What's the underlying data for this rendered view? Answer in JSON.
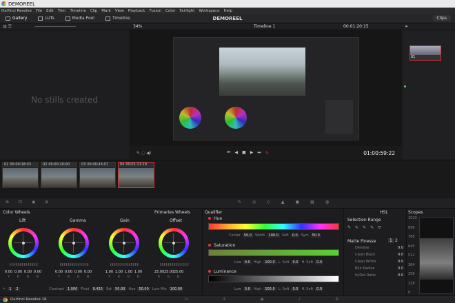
{
  "window": {
    "title": "DEMOREEL"
  },
  "menu": [
    "DaVinci Resolve",
    "File",
    "Edit",
    "Trim",
    "Timeline",
    "Clip",
    "Mark",
    "View",
    "Playback",
    "Fusion",
    "Color",
    "Fairlight",
    "Workspace",
    "Help"
  ],
  "toolbar": {
    "gallery": "Gallery",
    "luts": "LUTs",
    "media_pool": "Media Pool",
    "timeline": "Timeline",
    "project": "DEMOREEL",
    "clips": "Clips"
  },
  "viewer": {
    "zoom": "34%",
    "timeline_name": "Timeline 1",
    "timecode_top": "00:01:20:15",
    "timecode": "01:00:59:22"
  },
  "gallery": {
    "empty_text": "No stills created"
  },
  "nodes": {
    "node_label": "01"
  },
  "clips": [
    {
      "num": "01",
      "tc": "00:00:18:03"
    },
    {
      "num": "02",
      "tc": "00:00:20:00"
    },
    {
      "num": "03",
      "tc": "00:00:43:07"
    },
    {
      "num": "04",
      "tc": "00:01:11:10"
    }
  ],
  "color_wheels": {
    "title": "Color Wheels",
    "mode": "Primaries Wheels",
    "wheels": [
      {
        "name": "Lift",
        "values": [
          "0.00",
          "0.00",
          "0.00",
          "0.00"
        ]
      },
      {
        "name": "Gamma",
        "values": [
          "0.00",
          "0.00",
          "0.00",
          "0.00"
        ]
      },
      {
        "name": "Gain",
        "values": [
          "1.00",
          "1.00",
          "1.00",
          "1.00"
        ]
      },
      {
        "name": "Offset",
        "values": [
          "25.00",
          "25.00",
          "25.00"
        ]
      }
    ],
    "channels4": [
      "Y",
      "R",
      "G",
      "B"
    ],
    "channels3": [
      "R",
      "G",
      "B"
    ],
    "contrast_label": "Contrast",
    "contrast": "1.000",
    "pivot_label": "Pivot",
    "pivot": "0.435",
    "sat_label": "Sat",
    "sat": "50.00",
    "hue_label": "Hue",
    "hue": "50.00",
    "lummix_label": "Lum Mix",
    "lummix": "100.00",
    "page1": "1",
    "page2": "2"
  },
  "qualifier": {
    "title": "Qualifier",
    "hue": {
      "label": "Hue",
      "center": "50.0",
      "width": "100.0",
      "soft": "0.0",
      "sym": "50.0"
    },
    "saturation": {
      "label": "Saturation",
      "low": "0.0",
      "high": "100.0",
      "lsoft": "0.0",
      "hsoft": "0.0"
    },
    "luminance": {
      "label": "Luminance",
      "low": "0.0",
      "high": "100.0",
      "lsoft": "0.0",
      "hsoft": "0.0"
    },
    "labels": {
      "center": "Center",
      "width": "Width",
      "soft": "Soft",
      "sym": "Sym",
      "low": "Low",
      "high": "High",
      "lsoft": "L. Soft",
      "hsoft": "H. Soft"
    }
  },
  "selection": {
    "mode": "HSL",
    "title": "Selection Range",
    "matte_title": "Matte Finesse",
    "rows": [
      {
        "label": "Denoise",
        "value": "0.0"
      },
      {
        "label": "Clean Black",
        "value": "0.0"
      },
      {
        "label": "Clean White",
        "value": "0.0"
      },
      {
        "label": "Blur Radius",
        "value": "0.0"
      },
      {
        "label": "In/Out Ratio",
        "value": "0.0"
      }
    ],
    "page1": "1",
    "page2": "2"
  },
  "scopes": {
    "title": "Scopes",
    "ticks": [
      "1023",
      "896",
      "768",
      "640",
      "512",
      "384",
      "256",
      "128",
      "0"
    ]
  },
  "status": {
    "app": "DaVinci Resolve 16"
  }
}
